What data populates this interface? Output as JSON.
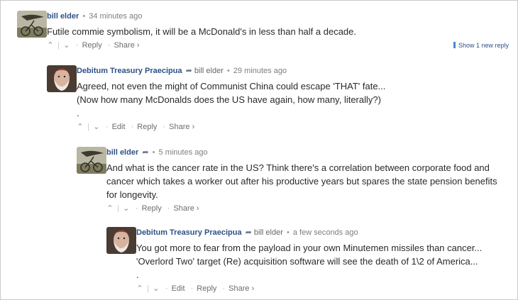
{
  "show_new_replies": "Show 1 new reply",
  "actions": {
    "up": "⌃",
    "down": "⌄",
    "edit": "Edit",
    "reply": "Reply",
    "share": "Share ›",
    "dot": "·",
    "pipe": "|"
  },
  "comments": [
    {
      "author": "bill elder",
      "time": "34 minutes ago",
      "text": "Futile commie symbolism, it will be a McDonald's in less than half a decade."
    },
    {
      "author": "Debitum Treasury Praecipua",
      "reply_to": "bill elder",
      "time": "29 minutes ago",
      "text": "Agreed, not even the might of Communist China could escape 'THAT' fate...\n(Now how many McDonalds does the US have again, how many, literally?)\n."
    },
    {
      "author": "bill elder",
      "time": "5 minutes ago",
      "text": "And what is the cancer rate in the US? Think there's a correlation between corporate food and\ncancer which takes a worker out after his productive years but spares the state pension benefits\nfor longevity."
    },
    {
      "author": "Debitum Treasury Praecipua",
      "reply_to": "bill elder",
      "time": "a few seconds ago",
      "text": "You got more to fear from the payload in your own Minutemen missiles than cancer...\n'Overlord Two' target (Re) acquisition software will see the death of 1\\2 of America...\n."
    }
  ]
}
